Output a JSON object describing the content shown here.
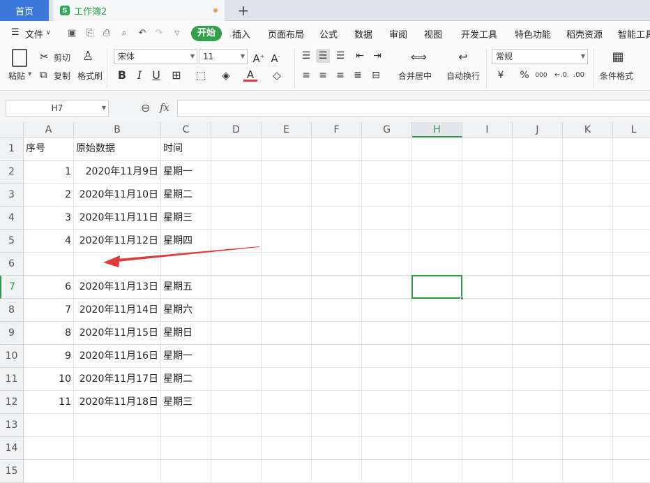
{
  "tabs": {
    "home": "首页",
    "workbook": "工作簿2",
    "add": "+"
  },
  "menu": {
    "file": "文件",
    "items": [
      "开始",
      "插入",
      "页面布局",
      "公式",
      "数据",
      "审阅",
      "视图",
      "开发工具",
      "特色功能",
      "稻壳资源",
      "智能工具"
    ]
  },
  "ribbon": {
    "paste": "粘贴",
    "cut": "剪切",
    "copy": "复制",
    "format_painter": "格式刷",
    "font_name": "宋体",
    "font_size": "11",
    "merge_center": "合并居中",
    "wrap_text": "自动换行",
    "number_format": "常规",
    "currency": "¥",
    "percent": "%",
    "thousands": "000",
    "cond_format": "条件格式"
  },
  "formula_bar": {
    "name_box": "H7",
    "fx": "fx",
    "value": ""
  },
  "grid": {
    "columns": [
      "A",
      "B",
      "C",
      "D",
      "E",
      "F",
      "G",
      "H",
      "I",
      "J",
      "K",
      "L"
    ],
    "selected_column": "H",
    "rows": [
      "1",
      "2",
      "3",
      "4",
      "5",
      "6",
      "7",
      "8",
      "9",
      "10",
      "11",
      "12",
      "13",
      "14",
      "15"
    ],
    "selected_row": "7",
    "selected_cell": "H7",
    "data": [
      [
        "序号",
        "原始数据",
        "时间"
      ],
      [
        "1",
        "2020年11月9日",
        "星期一"
      ],
      [
        "2",
        "2020年11月10日",
        "星期二"
      ],
      [
        "3",
        "2020年11月11日",
        "星期三"
      ],
      [
        "4",
        "2020年11月12日",
        "星期四"
      ],
      [
        "",
        "",
        ""
      ],
      [
        "6",
        "2020年11月13日",
        "星期五"
      ],
      [
        "7",
        "2020年11月14日",
        "星期六"
      ],
      [
        "8",
        "2020年11月15日",
        "星期日"
      ],
      [
        "9",
        "2020年11月16日",
        "星期一"
      ],
      [
        "10",
        "2020年11月17日",
        "星期二"
      ],
      [
        "11",
        "2020年11月18日",
        "星期三"
      ],
      [
        "",
        "",
        ""
      ],
      [
        "",
        "",
        ""
      ],
      [
        "",
        "",
        ""
      ]
    ]
  },
  "annotation": {
    "arrow_color": "#e03a3a"
  },
  "colors": {
    "accent": "#2d9a45",
    "tab_blue": "#3b78dc"
  }
}
